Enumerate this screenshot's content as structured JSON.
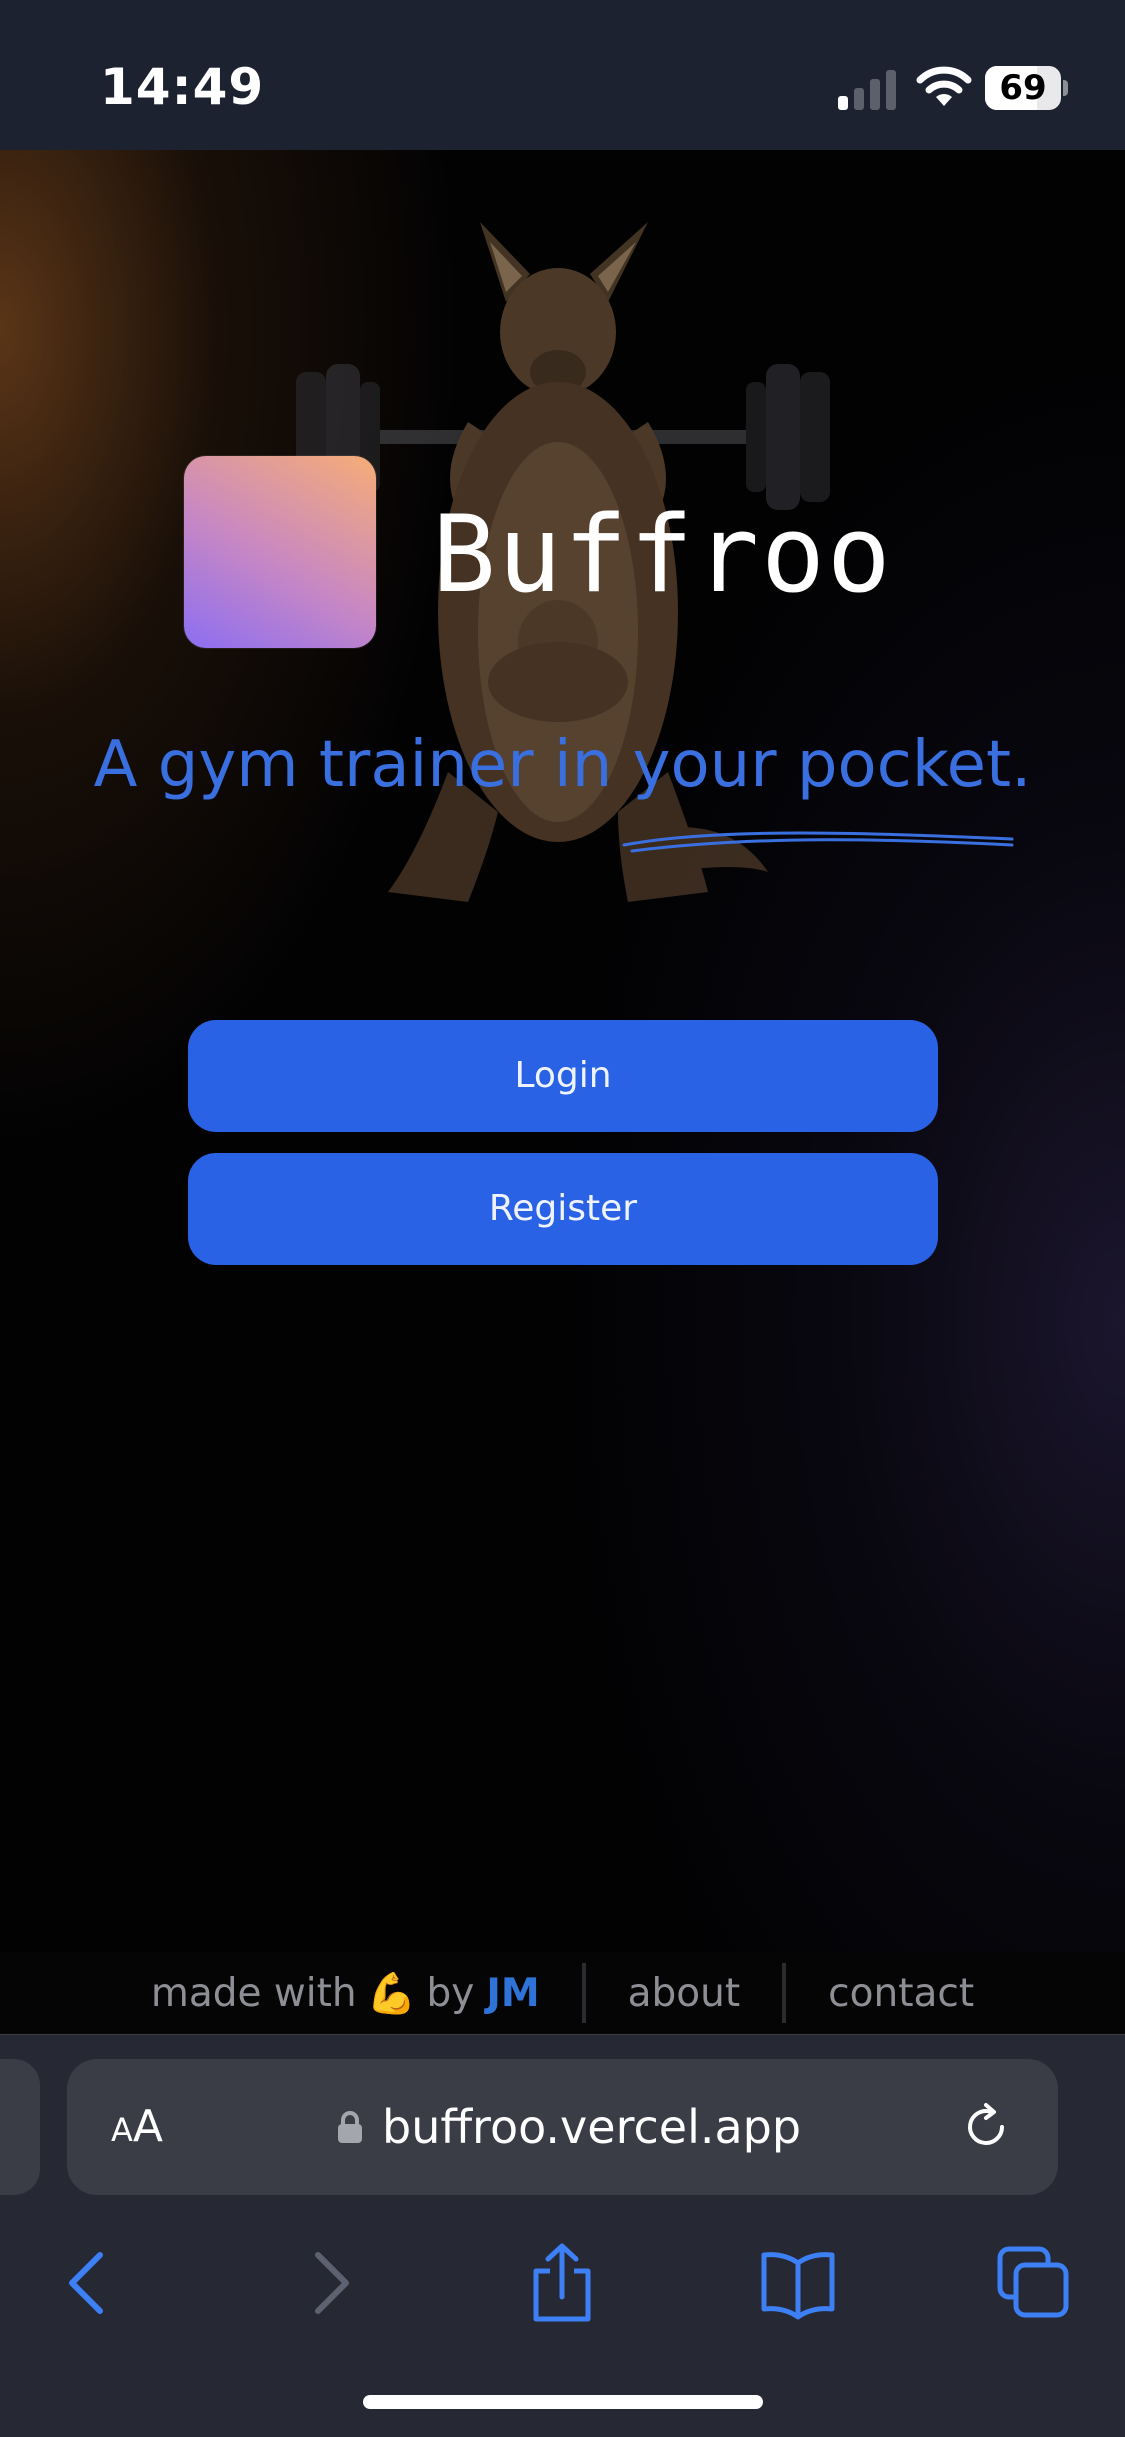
{
  "status_bar": {
    "time": "14:49",
    "battery_percent": "69",
    "battery_level": 0.69,
    "icons": [
      "signal-icon",
      "wifi-icon",
      "battery-icon"
    ]
  },
  "hero": {
    "brand_name": "Buffroo",
    "tagline": "A gym trainer in your pocket.",
    "logo_colors": [
      "#8c6ef2",
      "#c787c4",
      "#f6ad76"
    ],
    "art": "kangaroo-lifting-barbell-illustration"
  },
  "actions": {
    "login_label": "Login",
    "register_label": "Register",
    "button_color": "#2a62e6"
  },
  "footer": {
    "made_with": "made with",
    "emoji": "💪",
    "by": "by",
    "author": "JM",
    "about": "about",
    "contact": "contact"
  },
  "browser": {
    "text_size_small": "A",
    "text_size_large": "A",
    "url": "buffroo.vercel.app",
    "icons": [
      "back-icon",
      "forward-icon",
      "share-icon",
      "bookmarks-icon",
      "tabs-icon",
      "reload-icon",
      "lock-icon"
    ]
  },
  "colors": {
    "accent": "#2a62e6",
    "tagline": "#3a6fe0",
    "author": "#2f73d8"
  }
}
